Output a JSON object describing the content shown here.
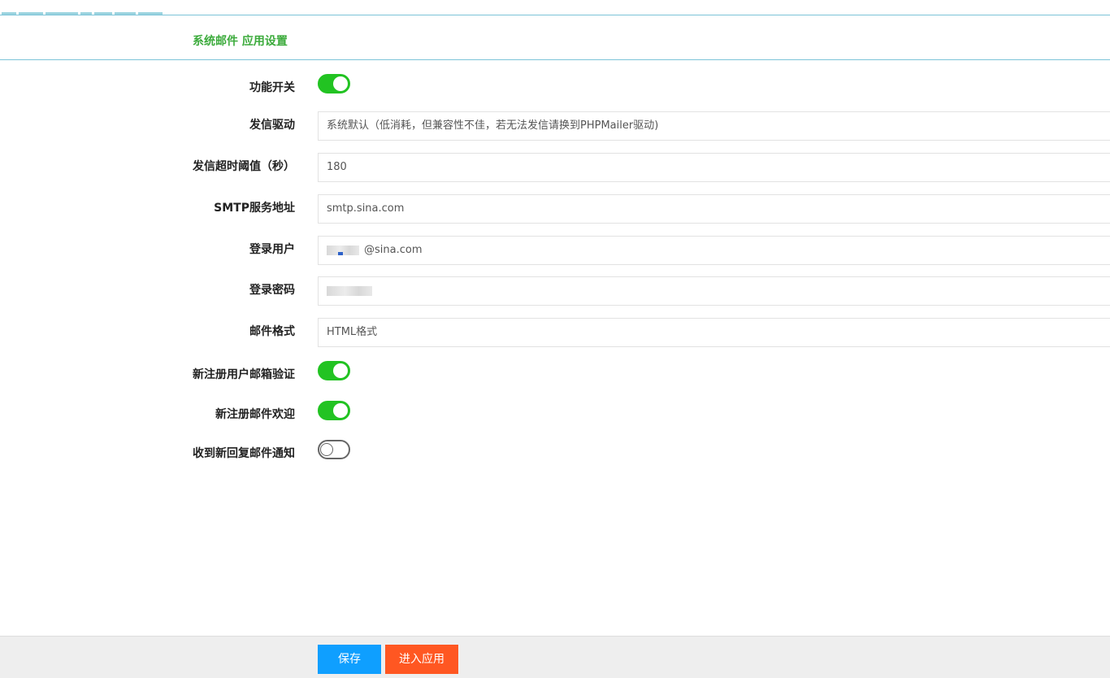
{
  "header": {
    "title": "系统邮件 应用设置"
  },
  "form": {
    "enable": {
      "label": "功能开关",
      "on": true
    },
    "driver": {
      "label": "发信驱动",
      "value": "系统默认（低消耗，但兼容性不佳，若无法发信请换到PHPMailer驱动)"
    },
    "timeout": {
      "label": "发信超时阈值（秒）",
      "value": "180"
    },
    "smtp": {
      "label": "SMTP服务地址",
      "value": "smtp.sina.com"
    },
    "user": {
      "label": "登录用户",
      "value": "@sina.com"
    },
    "password": {
      "label": "登录密码",
      "value": ""
    },
    "format": {
      "label": "邮件格式",
      "value": "HTML格式"
    },
    "verify": {
      "label": "新注册用户邮箱验证",
      "on": true
    },
    "welcome": {
      "label": "新注册邮件欢迎",
      "on": true
    },
    "reply_notify": {
      "label": "收到新回复邮件通知",
      "on": false
    }
  },
  "footer": {
    "save_label": "保存",
    "enter_label": "进入应用"
  },
  "colors": {
    "title": "#3cab3c",
    "switch_on": "#22c322",
    "save_button": "#0f9fff",
    "enter_button": "#ff5722"
  }
}
